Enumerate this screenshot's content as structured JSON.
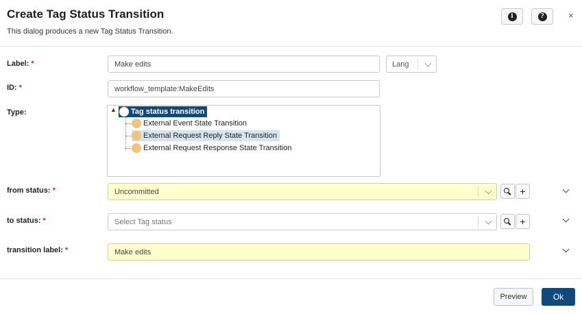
{
  "dialog": {
    "title": "Create Tag Status Transition",
    "subtitle": "This dialog produces a new Tag Status Transition.",
    "info_icon": "info-icon",
    "help_icon": "help-icon",
    "close_glyph": "×"
  },
  "fields": {
    "label": {
      "label": "Label:",
      "value": "Make edits",
      "lang_placeholder": "Lang"
    },
    "id": {
      "label": "ID:",
      "value": "workflow_template:MakeEdits"
    },
    "type": {
      "label": "Type:",
      "tree": {
        "root": "Tag status transition",
        "children": [
          "External Event State Transition",
          "External Request Reply State Transition",
          "External Request Response State Transition"
        ]
      }
    },
    "from_status": {
      "label": "from status:",
      "value": "Uncommitted"
    },
    "to_status": {
      "label": "to status:",
      "placeholder": "Select Tag status"
    },
    "transition_label": {
      "label": "transition label:",
      "value": "Make edits"
    }
  },
  "required_marker": "*",
  "buttons": {
    "preview": "Preview",
    "ok": "Ok",
    "add": "+"
  },
  "colors": {
    "accent": "#0e4a7d",
    "required_bg": "#ffffcc",
    "node_dot": "#f2c47a",
    "required_star": "#d0252a"
  }
}
